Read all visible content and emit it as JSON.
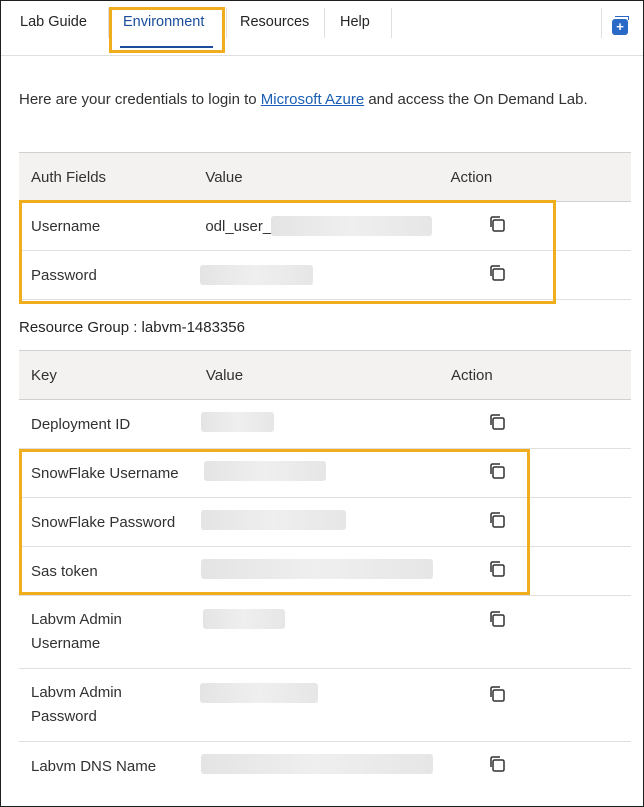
{
  "tabs": [
    {
      "label": "Lab Guide",
      "active": false
    },
    {
      "label": "Environment",
      "active": true
    },
    {
      "label": "Resources",
      "active": false
    },
    {
      "label": "Help",
      "active": false
    }
  ],
  "intro": {
    "before": "Here are your credentials to login to ",
    "link": "Microsoft Azure",
    "after": " and access the On Demand Lab."
  },
  "auth_table": {
    "headers": [
      "Auth Fields",
      "Value",
      "Action"
    ],
    "rows": [
      {
        "key": "Username",
        "value_prefix": "odl_user_",
        "redacted": true
      },
      {
        "key": "Password",
        "value_prefix": "",
        "redacted": true
      }
    ]
  },
  "resource_group": {
    "title": "Resource Group : labvm-1483356"
  },
  "resource_table": {
    "headers": [
      "Key",
      "Value",
      "Action"
    ],
    "rows": [
      {
        "key": "Deployment ID",
        "redacted": true
      },
      {
        "key": "SnowFlake Username",
        "redacted": true
      },
      {
        "key": "SnowFlake Password",
        "redacted": true
      },
      {
        "key": "Sas token",
        "redacted": true
      },
      {
        "key_line1": "Labvm Admin",
        "key_line2": "Username",
        "redacted": true
      },
      {
        "key_line1": "Labvm Admin",
        "key_line2": "Password",
        "redacted": true
      },
      {
        "key": "Labvm DNS Name",
        "redacted": true
      }
    ]
  },
  "icons": {
    "copy": "copy-icon",
    "collapse": "collapse-panel-icon"
  },
  "colors": {
    "highlight": "#f0ad1e",
    "link": "#1a5fb4",
    "active_tab": "#1a4d9c",
    "header_bg": "#f3f2f1"
  }
}
